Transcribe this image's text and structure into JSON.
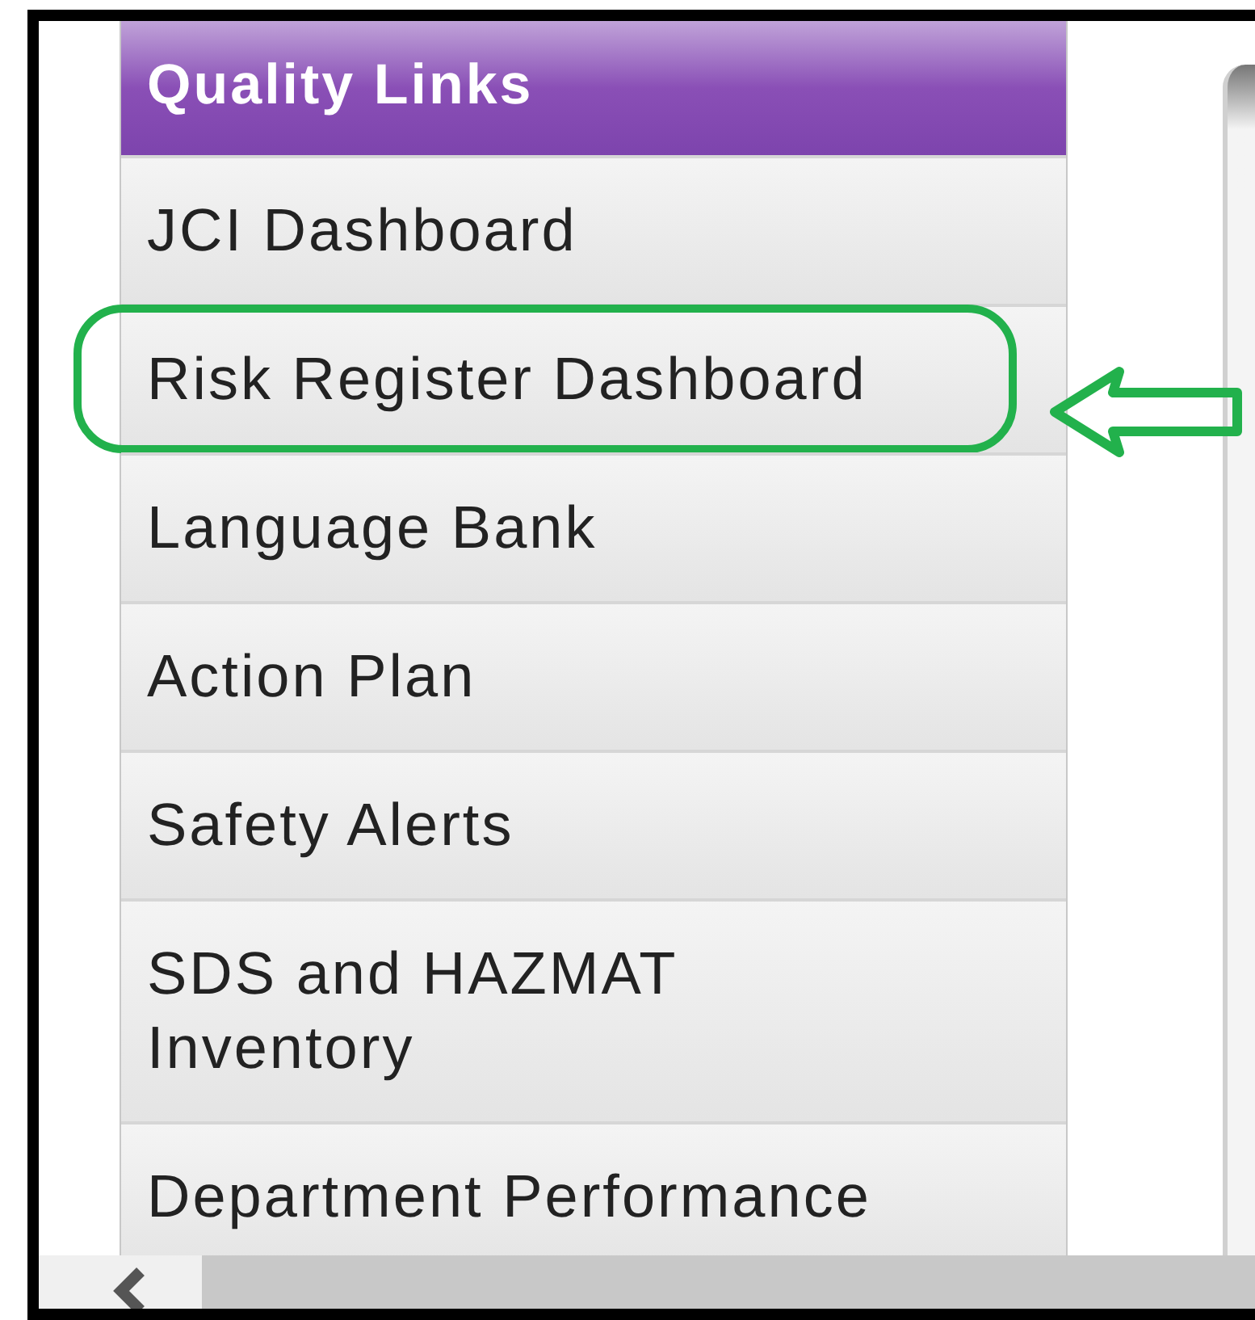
{
  "sidebar": {
    "title": "Quality Links",
    "items": [
      {
        "label": "JCI Dashboard",
        "highlighted": false
      },
      {
        "label": "Risk Register Dashboard",
        "highlighted": true
      },
      {
        "label": "Language Bank",
        "highlighted": false
      },
      {
        "label": "Action Plan",
        "highlighted": false
      },
      {
        "label": "Safety Alerts",
        "highlighted": false
      },
      {
        "label": "SDS and HAZMAT Inventory",
        "highlighted": false
      },
      {
        "label": "Department Performance",
        "highlighted": false
      }
    ]
  }
}
